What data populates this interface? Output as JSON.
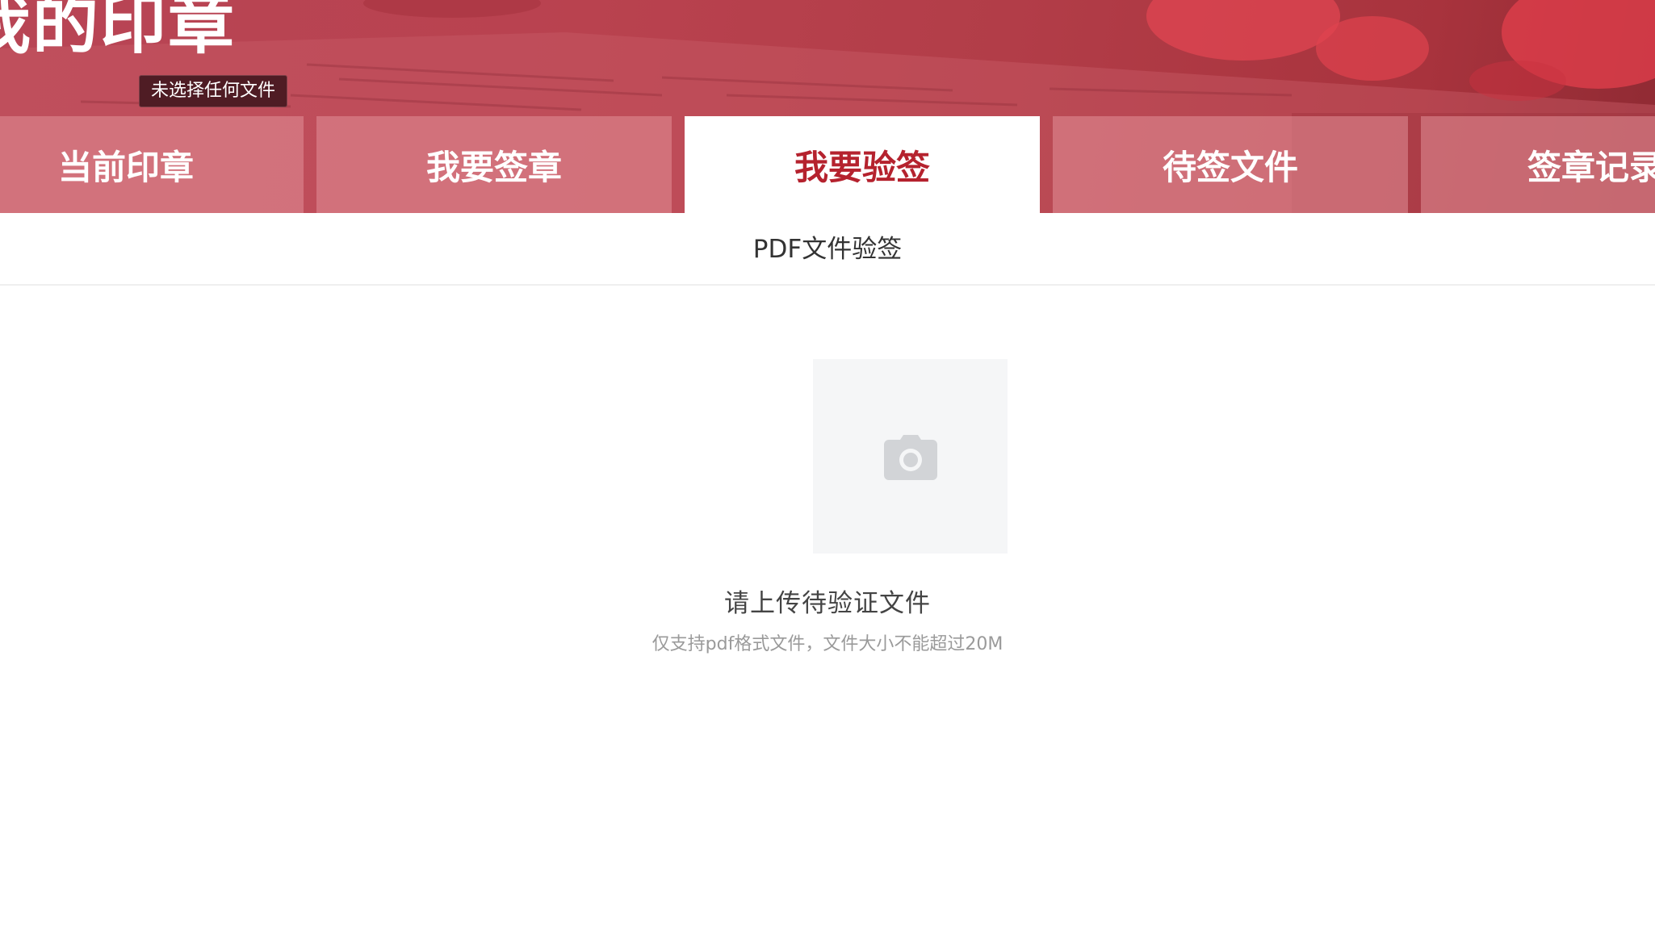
{
  "header": {
    "title": "我的印章",
    "file_tooltip": "未选择任何文件"
  },
  "tabs": [
    {
      "label": "当前印章",
      "active": false
    },
    {
      "label": "我要签章",
      "active": false
    },
    {
      "label": "我要验签",
      "active": true
    },
    {
      "label": "待签文件",
      "active": false
    },
    {
      "label": "签章记录",
      "active": false
    }
  ],
  "section": {
    "title": "PDF文件验签"
  },
  "upload": {
    "icon": "camera-icon",
    "title": "请上传待验证文件",
    "hint": "仅支持pdf格式文件，文件大小不能超过20M"
  },
  "colors": {
    "brand_red": "#b5222e",
    "banner": "#b9424f",
    "tab_inactive": "#e29098",
    "upload_bg": "#f5f6f7",
    "icon_gray": "#d2d4d7"
  }
}
